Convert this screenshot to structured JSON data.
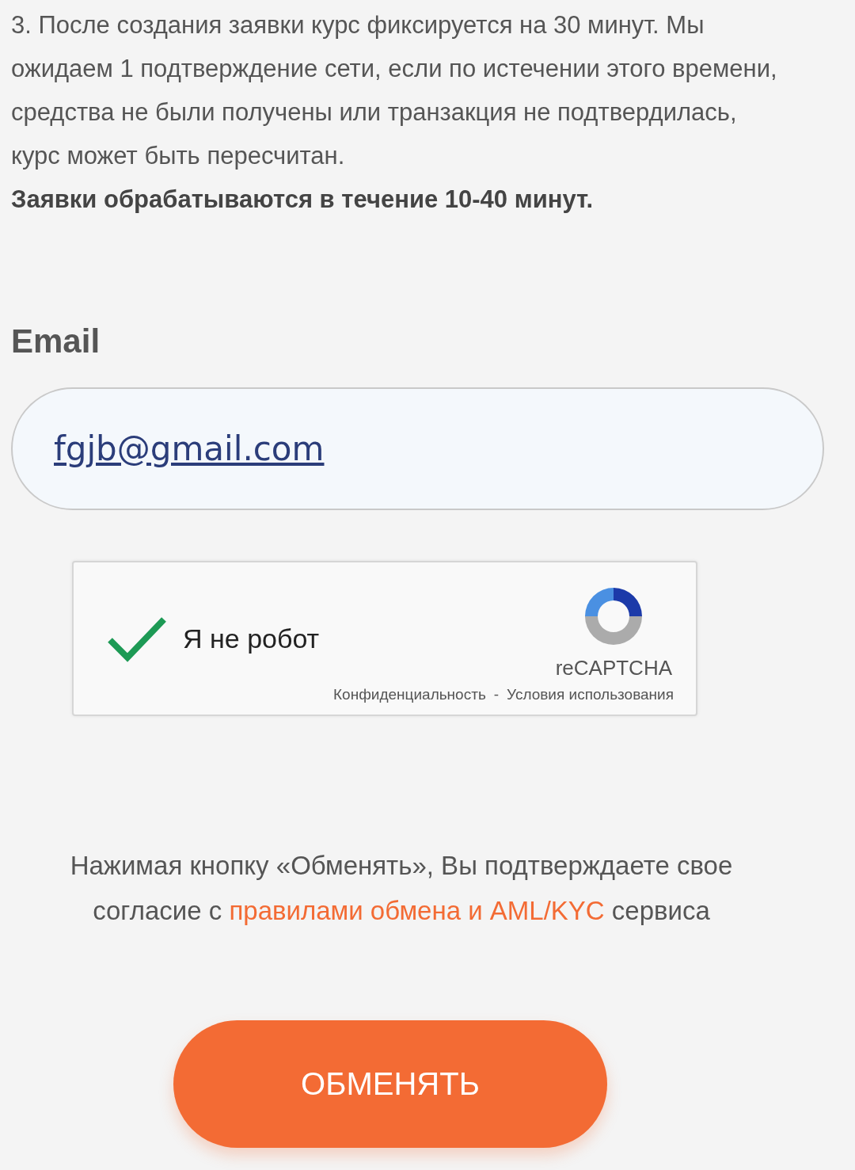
{
  "notice": {
    "paragraph": "3. После создания заявки курс фиксируется на 30 минут. Мы ожидаем 1 подтверждение сети, если по истечении этого времени, средства не были получены или транзакция не подтвердилась, курс может быть пересчитан.",
    "bold_line": "Заявки обрабатываются в течение 10-40 минут."
  },
  "email": {
    "label": "Email",
    "value": "fgjb@gmail.com"
  },
  "captcha": {
    "checked": true,
    "label": "Я не робот",
    "brand": "reCAPTCHA",
    "privacy": "Конфиденциальность",
    "separator": "-",
    "terms": "Условия использования"
  },
  "consent": {
    "text": "Нажимая кнопку «Обменять», Вы подтверждаете свое согласие с",
    "link": "правилами обмена и AML/KYC",
    "suffix": "сервиса"
  },
  "submit": "ОБМЕНЯТЬ"
}
